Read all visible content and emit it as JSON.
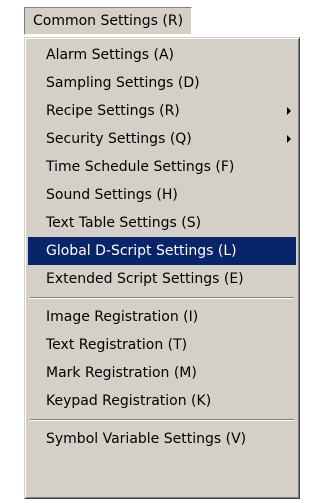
{
  "menubar": {
    "label": "Common Settings (R)"
  },
  "menu": {
    "group1": [
      {
        "label": "Alarm Settings (A)"
      },
      {
        "label": "Sampling Settings (D)"
      },
      {
        "label": "Recipe Settings (R)"
      },
      {
        "label": "Security Settings (Q)"
      },
      {
        "label": "Time Schedule Settings (F)"
      },
      {
        "label": "Sound Settings (H)"
      },
      {
        "label": "Text Table Settings (S)"
      },
      {
        "label": "Global D-Script Settings (L)"
      },
      {
        "label": "Extended Script Settings (E)"
      }
    ],
    "group2": [
      {
        "label": "Image Registration (I)"
      },
      {
        "label": "Text Registration (T)"
      },
      {
        "label": "Mark Registration (M)"
      },
      {
        "label": "Keypad Registration (K)"
      }
    ],
    "group3": [
      {
        "label": "Symbol Variable Settings (V)"
      }
    ]
  },
  "colors": {
    "menu_bg": "#d4d0c8",
    "highlight": "#0a246a",
    "highlight_text": "#ffffff"
  },
  "icons": {
    "submenu": "submenu-arrow-icon"
  }
}
